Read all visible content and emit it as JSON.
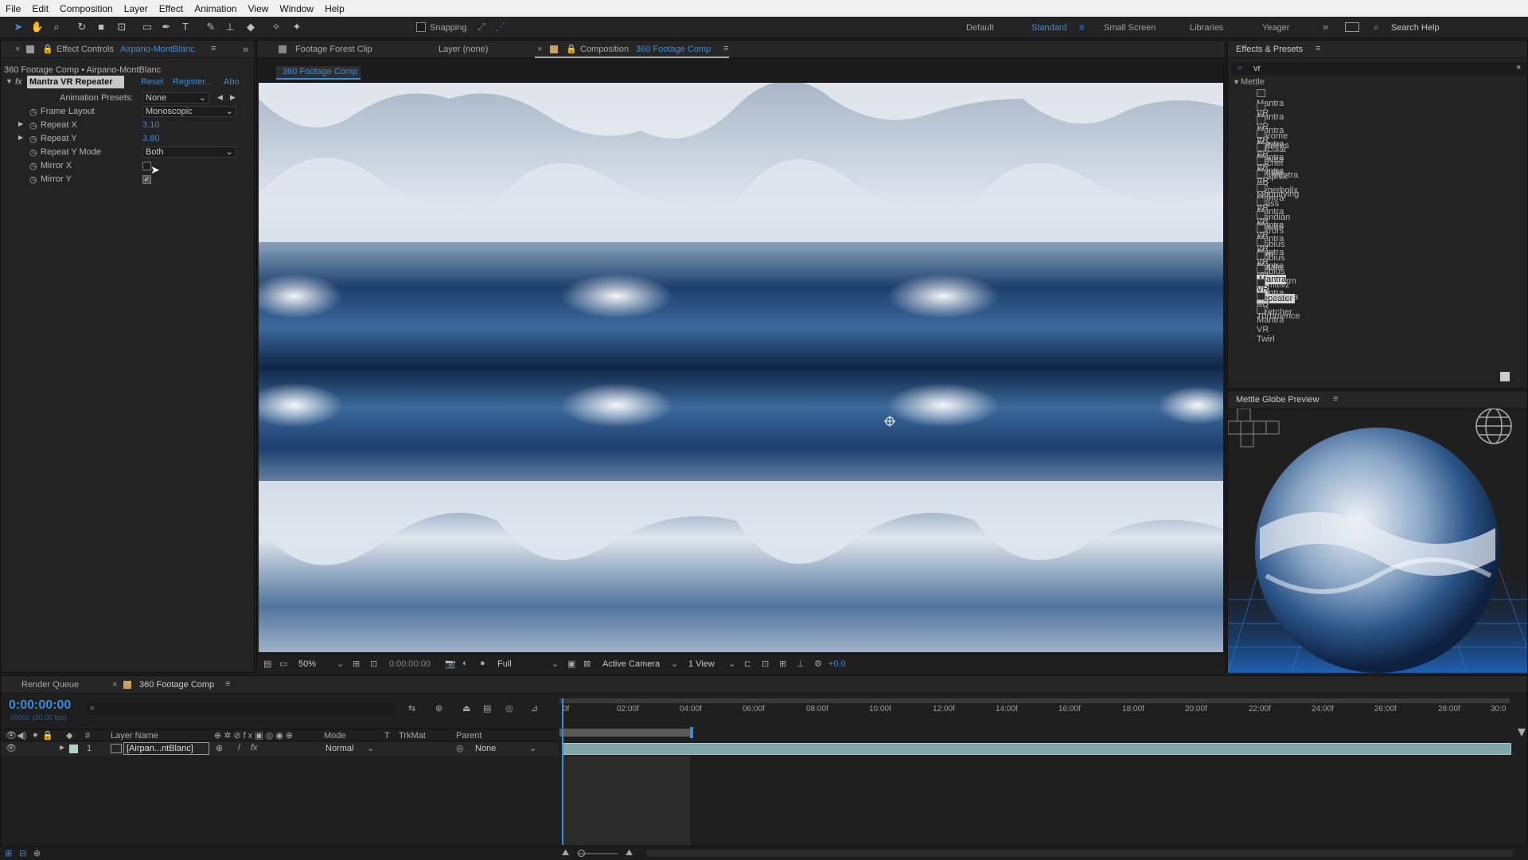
{
  "menu": [
    "File",
    "Edit",
    "Composition",
    "Layer",
    "Effect",
    "Animation",
    "View",
    "Window",
    "Help"
  ],
  "toolbar": {
    "snapping_label": "Snapping",
    "workspaces": [
      "Default",
      "Standard",
      "Small Screen",
      "Libraries",
      "Yeager"
    ],
    "active_workspace": "Standard",
    "search_help": "Search Help"
  },
  "effect_controls": {
    "tab_label": "Effect Controls",
    "layer_name": "Airpano-MontBlanc",
    "breadcrumb": "360 Footage Comp • Airpano-MontBlanc",
    "effect_name": "Mantra VR Repeater",
    "reset": "Reset",
    "register": "Register...",
    "about": "Abo",
    "properties": [
      {
        "label": "Animation Presets:",
        "value": "None",
        "type": "dropdown"
      },
      {
        "label": "Frame Layout",
        "value": "Monoscopic",
        "type": "dropdown"
      },
      {
        "label": "Repeat X",
        "value": "3.10",
        "type": "number"
      },
      {
        "label": "Repeat Y",
        "value": "3.80",
        "type": "number"
      },
      {
        "label": "Repeat Y Mode",
        "value": "Both",
        "type": "dropdown"
      },
      {
        "label": "Mirror X",
        "value": "unchecked",
        "type": "checkbox"
      },
      {
        "label": "Mirror Y",
        "value": "checked",
        "type": "checkbox"
      }
    ]
  },
  "viewer": {
    "tabs": [
      {
        "label": "Footage Forest Clip"
      },
      {
        "label": "Layer (none)"
      },
      {
        "label": "Composition",
        "comp": "360 Footage Comp"
      }
    ],
    "comp_tab": "360 Footage Comp",
    "zoom": "50%",
    "timecode": "0:00:00:00",
    "resolution": "Full",
    "camera": "Active Camera",
    "views": "1 View",
    "exposure": "+0.0"
  },
  "effects_presets": {
    "title": "Effects & Presets",
    "search_value": "vr",
    "category": "Mettle",
    "items": [
      "Mantra VR",
      "Mantra VR Chrome Spheres",
      "Mantra VR Circular Waves",
      "Mantra VR Escher Droste",
      "Mantra VR Graphix",
      "Mantra VR Hyperbolix",
      "Mantra VR Magnifying Glass",
      "Mantra VR Meridian Waves",
      "Mantra VR Mirrors",
      "Mantra VR Mobius Raw",
      "Mantra VR Mobius Rotate",
      "Mantra VR Mobius Transform",
      "Mantra VR Primitivz",
      "Mantra VR Repeater",
      "Mantra VR Stretcher",
      "Mantra VR Turbulence",
      "Mantra VR Twirl"
    ],
    "selected": "Mantra VR Repeater"
  },
  "globe_preview": {
    "title": "Mettle Globe Preview"
  },
  "timeline": {
    "render_queue": "Render Queue",
    "comp_tab": "360 Footage Comp",
    "timecode": "0:00:00:00",
    "timecode_sub": "00000 (30.00 fps)",
    "columns": {
      "layer_name": "Layer Name",
      "mode": "Mode",
      "t": "T",
      "trkmat": "TrkMat",
      "parent": "Parent"
    },
    "layer": {
      "index": "1",
      "name": "[Airpan...ntBlanc]",
      "mode": "Normal",
      "parent": "None"
    },
    "ruler": [
      "0f",
      "02:00f",
      "04:00f",
      "06:00f",
      "08:00f",
      "10:00f",
      "12:00f",
      "14:00f",
      "16:00f",
      "18:00f",
      "20:00f",
      "22:00f",
      "24:00f",
      "26:00f",
      "28:00f",
      "30:0"
    ]
  },
  "colors": {
    "accent": "#3c8cdc",
    "panel": "#232323",
    "layer_bar": "#7fa7a7",
    "work_area": "#5a5a5a"
  }
}
